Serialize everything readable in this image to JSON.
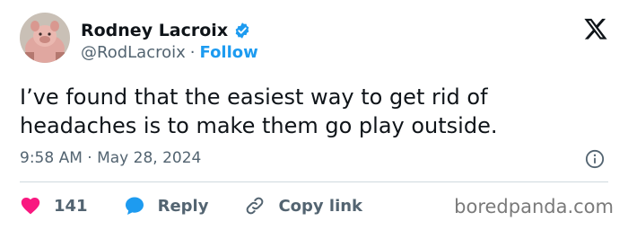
{
  "author": {
    "display_name": "Rodney Lacroix",
    "handle": "@RodLacroix",
    "separator": "·",
    "follow_label": "Follow",
    "verified_icon": "verified-badge-icon",
    "avatar": "pig-avatar"
  },
  "tweet": {
    "line1": "I’ve found that the easiest way to get rid of",
    "line2": "headaches is to make them go play outside.",
    "timestamp": "9:58 AM · May 28, 2024"
  },
  "actions": {
    "like_count": "141",
    "reply_label": "Reply",
    "copy_label": "Copy link"
  },
  "watermark": "boredpanda.com",
  "colors": {
    "accent": "#1d9bf0",
    "like": "#f91880",
    "secondary_text": "#536471",
    "primary_text": "#0f1419",
    "divider": "#cfd9de"
  },
  "icons": [
    "x-logo-icon",
    "info-icon",
    "heart-icon",
    "reply-bubble-icon",
    "link-icon"
  ]
}
